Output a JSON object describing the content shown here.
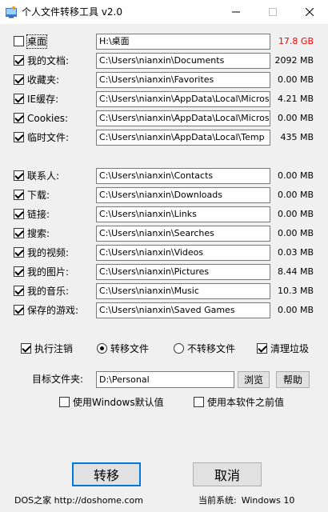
{
  "window": {
    "title": "个人文件转移工具 v2.0",
    "controls": [
      "minimize-icon",
      "maximize-icon",
      "close-icon"
    ]
  },
  "folders": [
    {
      "label": "桌面",
      "checked": false,
      "path": "H:\\桌面",
      "size": "17.8 GB",
      "size_color": "#ff0000",
      "focused": true
    },
    {
      "label": "我的文档:",
      "checked": true,
      "path": "C:\\Users\\nianxin\\Documents",
      "size": "2092 MB"
    },
    {
      "label": "收藏夹:",
      "checked": true,
      "path": "C:\\Users\\nianxin\\Favorites",
      "size": "0.00 MB"
    },
    {
      "label": "IE缓存:",
      "checked": true,
      "path": "C:\\Users\\nianxin\\AppData\\Local\\Microsoft\\Windows\\INetCache",
      "size": "4.21 MB"
    },
    {
      "label": "Cookies:",
      "checked": true,
      "path": "C:\\Users\\nianxin\\AppData\\Local\\Microsoft\\Windows\\INetCookies",
      "size": "0.00 MB"
    },
    {
      "label": "临时文件:",
      "checked": true,
      "path": "C:\\Users\\nianxin\\AppData\\Local\\Temp",
      "size": "435  MB"
    },
    {
      "label": "联系人:",
      "checked": true,
      "path": "C:\\Users\\nianxin\\Contacts",
      "size": "0.00 MB"
    },
    {
      "label": "下载:",
      "checked": true,
      "path": "C:\\Users\\nianxin\\Downloads",
      "size": "0.00 MB"
    },
    {
      "label": "链接:",
      "checked": true,
      "path": "C:\\Users\\nianxin\\Links",
      "size": "0.00 MB"
    },
    {
      "label": "搜索:",
      "checked": true,
      "path": "C:\\Users\\nianxin\\Searches",
      "size": "0.00 MB"
    },
    {
      "label": "我的视频:",
      "checked": true,
      "path": "C:\\Users\\nianxin\\Videos",
      "size": "0.03 MB"
    },
    {
      "label": "我的图片:",
      "checked": true,
      "path": "C:\\Users\\nianxin\\Pictures",
      "size": "8.44 MB"
    },
    {
      "label": "我的音乐:",
      "checked": true,
      "path": "C:\\Users\\nianxin\\Music",
      "size": "10.3 MB"
    },
    {
      "label": "保存的游戏:",
      "checked": true,
      "path": "C:\\Users\\nianxin\\Saved Games",
      "size": "0.00 MB"
    }
  ],
  "options": {
    "logoff": {
      "label": "执行注销",
      "checked": true
    },
    "transfer": {
      "label": "转移文件",
      "selected": true
    },
    "no_transfer": {
      "label": "不转移文件",
      "selected": false
    },
    "clean": {
      "label": "清理垃圾",
      "checked": true
    }
  },
  "target": {
    "label": "目标文件夹:",
    "value": "D:\\Personal",
    "browse_label": "浏览",
    "help_label": "帮助"
  },
  "defaults": {
    "windows_default": {
      "label": "使用Windows默认值",
      "checked": false
    },
    "previous": {
      "label": "使用本软件之前值",
      "checked": false
    }
  },
  "actions": {
    "transfer_label": "转移",
    "cancel_label": "取消"
  },
  "footer": {
    "site": "DOS之家 http://doshome.com",
    "os_label": "当前系统:",
    "os_value": "Windows 10"
  }
}
